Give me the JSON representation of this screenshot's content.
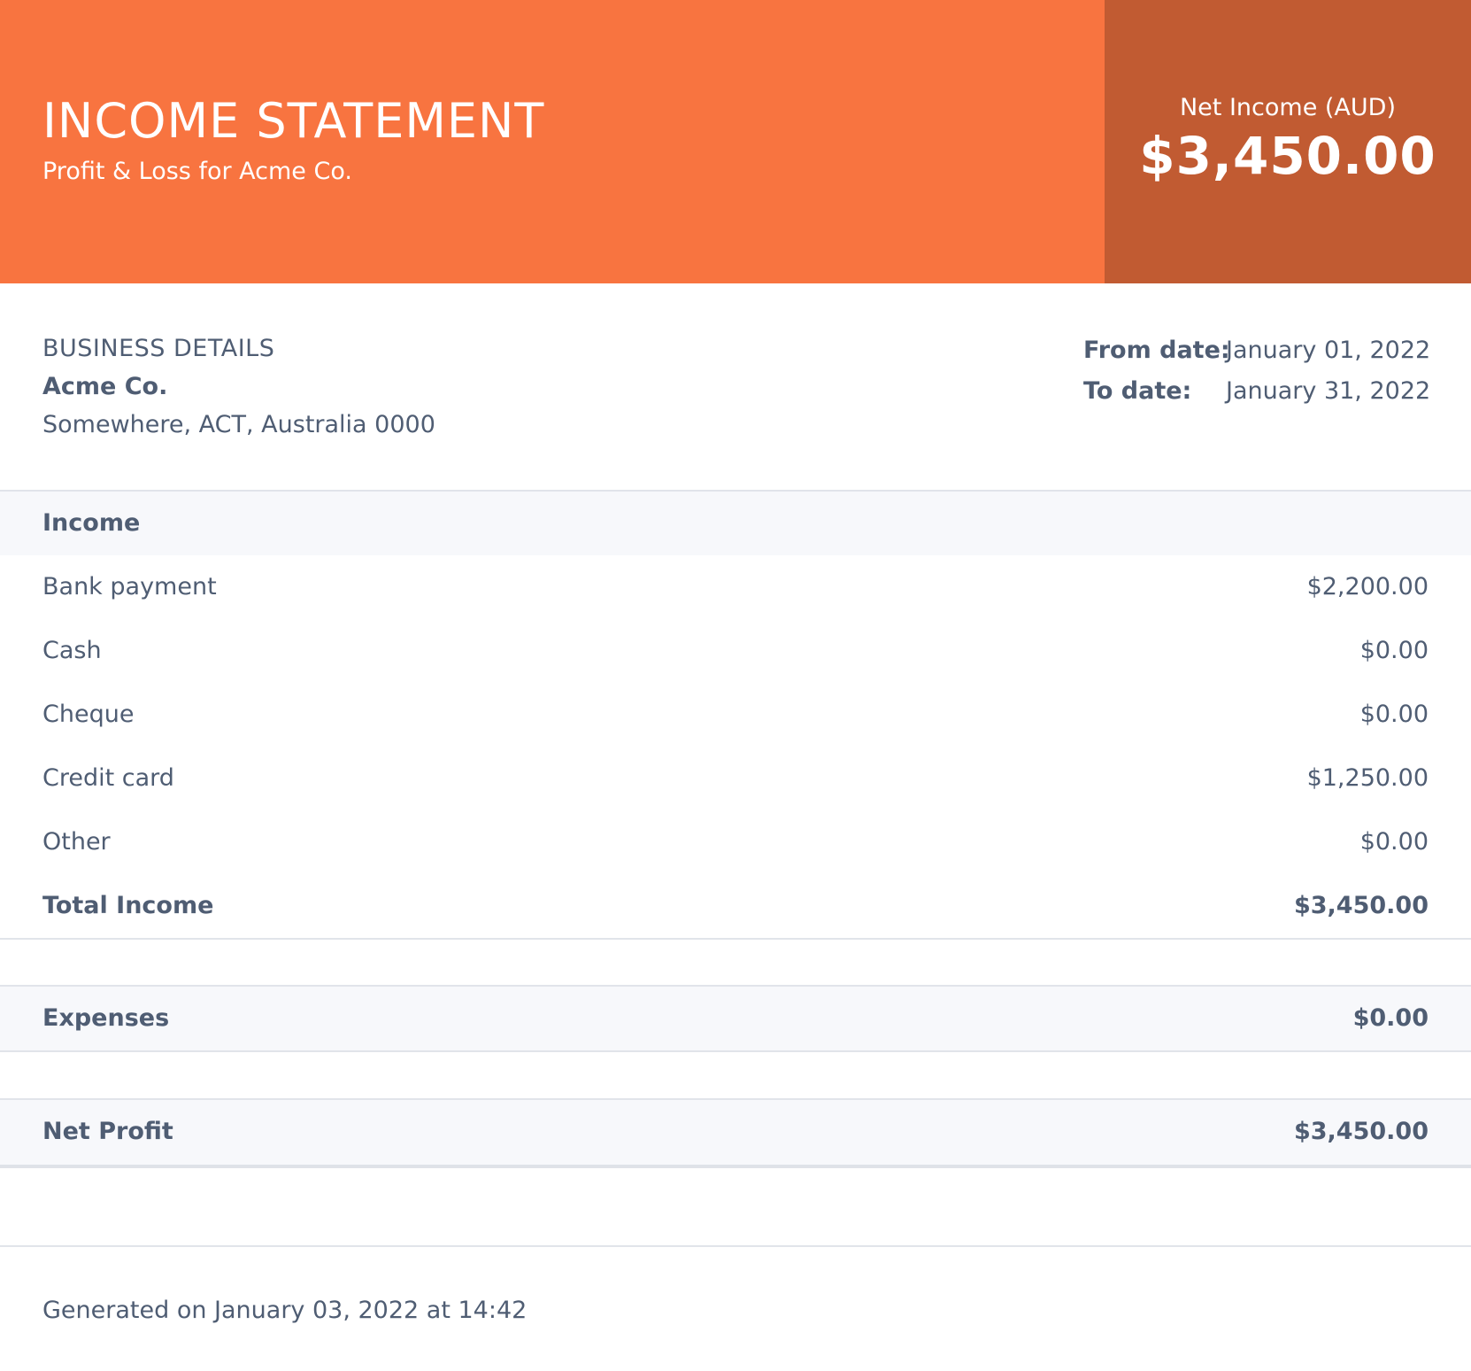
{
  "header": {
    "title": "INCOME STATEMENT",
    "subtitle": "Profit & Loss for Acme Co.",
    "net_income_label": "Net Income (AUD)",
    "net_income_value": "$3,450.00"
  },
  "business": {
    "heading": "BUSINESS DETAILS",
    "name": "Acme Co.",
    "address": "Somewhere, ACT, Australia 0000"
  },
  "period": {
    "from_label": "From date:",
    "from_value": "January 01, 2022",
    "to_label": "To date:",
    "to_value": "January 31, 2022"
  },
  "income": {
    "heading": "Income",
    "items": [
      {
        "label": "Bank payment",
        "value": "$2,200.00"
      },
      {
        "label": "Cash",
        "value": "$0.00"
      },
      {
        "label": "Cheque",
        "value": "$0.00"
      },
      {
        "label": "Credit card",
        "value": "$1,250.00"
      },
      {
        "label": "Other",
        "value": "$0.00"
      }
    ],
    "total_label": "Total Income",
    "total_value": "$3,450.00"
  },
  "expenses": {
    "label": "Expenses",
    "value": "$0.00"
  },
  "net_profit": {
    "label": "Net Profit",
    "value": "$3,450.00"
  },
  "footer": {
    "generated": "Generated on January 03, 2022 at 14:42"
  },
  "colors": {
    "header_bg": "#f87440",
    "net_box_bg": "#c15b32",
    "text": "#4f5d73",
    "band_bg": "#f7f8fb",
    "divider": "#e1e4ea"
  }
}
